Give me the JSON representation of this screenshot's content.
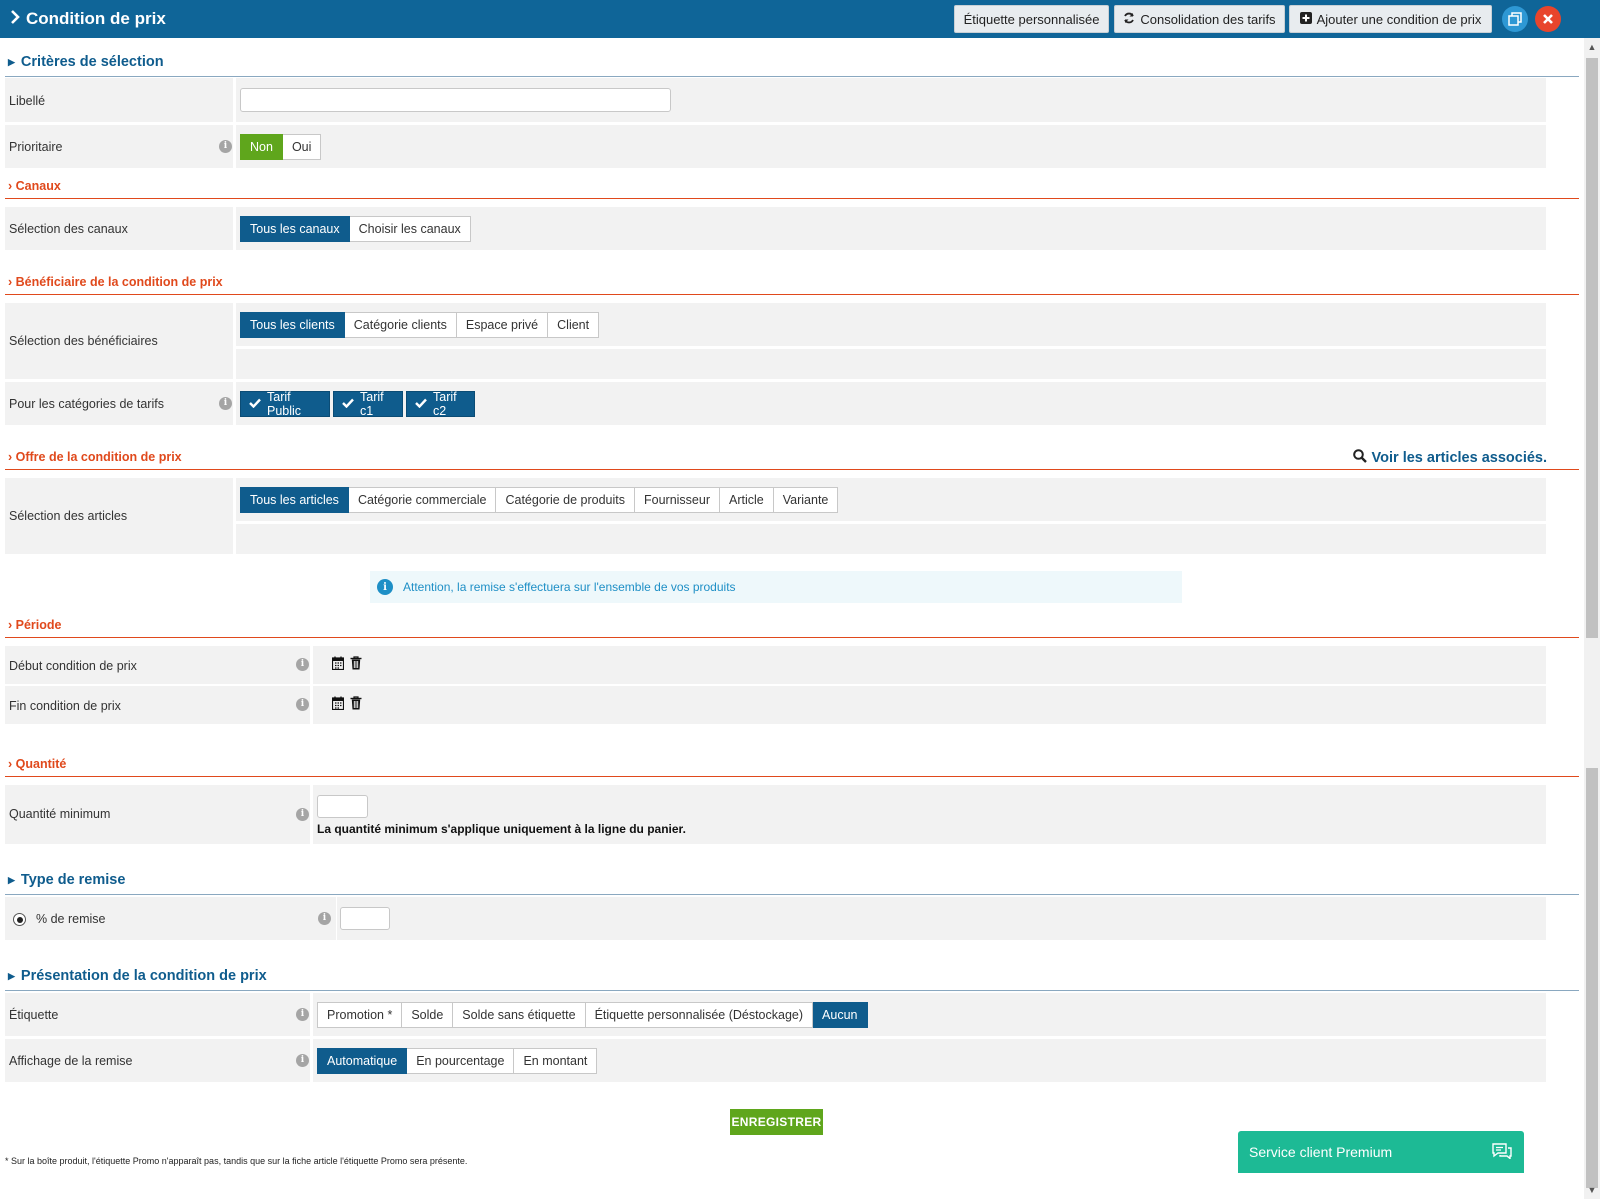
{
  "header": {
    "title": "Condition de prix",
    "btn_custom_label": "Étiquette personnalisée",
    "btn_consolidation": "Consolidation des tarifs",
    "btn_add_condition": "Ajouter une condition de prix"
  },
  "criteria": {
    "title": "Critères de sélection",
    "libelle_label": "Libellé",
    "libelle_value": "",
    "prioritaire_label": "Prioritaire",
    "prioritaire_options": [
      "Non",
      "Oui"
    ],
    "prioritaire_selected": "Non"
  },
  "canaux": {
    "title": "› Canaux",
    "selection_label": "Sélection des canaux",
    "options": [
      "Tous les canaux",
      "Choisir les canaux"
    ],
    "selected": "Tous les canaux"
  },
  "beneficiaire": {
    "title": "› Bénéficiaire de la condition de prix",
    "selection_label": "Sélection des bénéficiaires",
    "options": [
      "Tous les clients",
      "Catégorie clients",
      "Espace privé",
      "Client"
    ],
    "selected": "Tous les clients",
    "tarifs_label": "Pour les catégories de tarifs",
    "tarifs": [
      "Tarif Public",
      "Tarif c1",
      "Tarif c2"
    ]
  },
  "offre": {
    "title": "› Offre de la condition de prix",
    "link": "Voir les articles associés.",
    "selection_label": "Sélection des articles",
    "options": [
      "Tous les articles",
      "Catégorie commerciale",
      "Catégorie de produits",
      "Fournisseur",
      "Article",
      "Variante"
    ],
    "selected": "Tous les articles",
    "alert": "Attention, la remise s'effectuera sur l'ensemble de vos produits"
  },
  "periode": {
    "title": "› Période",
    "debut_label": "Début condition de prix",
    "fin_label": "Fin condition de prix"
  },
  "quantite": {
    "title": "› Quantité",
    "min_label": "Quantité minimum",
    "min_value": "",
    "note": "La quantité minimum s'applique uniquement à la ligne du panier."
  },
  "remise": {
    "title": "Type de remise",
    "percent_label": "% de remise",
    "percent_value": ""
  },
  "presentation": {
    "title": "Présentation de la condition de prix",
    "etiquette_label": "Étiquette",
    "etiquette_options": [
      "Promotion *",
      "Solde",
      "Solde sans étiquette",
      "Étiquette personnalisée (Déstockage)",
      "Aucun"
    ],
    "etiquette_selected": "Aucun",
    "affichage_label": "Affichage de la remise",
    "affichage_options": [
      "Automatique",
      "En pourcentage",
      "En montant"
    ],
    "affichage_selected": "Automatique"
  },
  "save_label": "ENREGISTRER",
  "footnote": "* Sur la boîte produit, l'étiquette Promo n'apparaît pas, tandis que sur la fiche article l'étiquette Promo sera présente.",
  "chat": {
    "label": "Service client Premium"
  },
  "colors": {
    "brand": "#0f6598",
    "active": "#0f5c8d",
    "success": "#5fa61c",
    "section_accent": "#e0491c",
    "chat": "#1dba95",
    "close": "#e8452c"
  }
}
